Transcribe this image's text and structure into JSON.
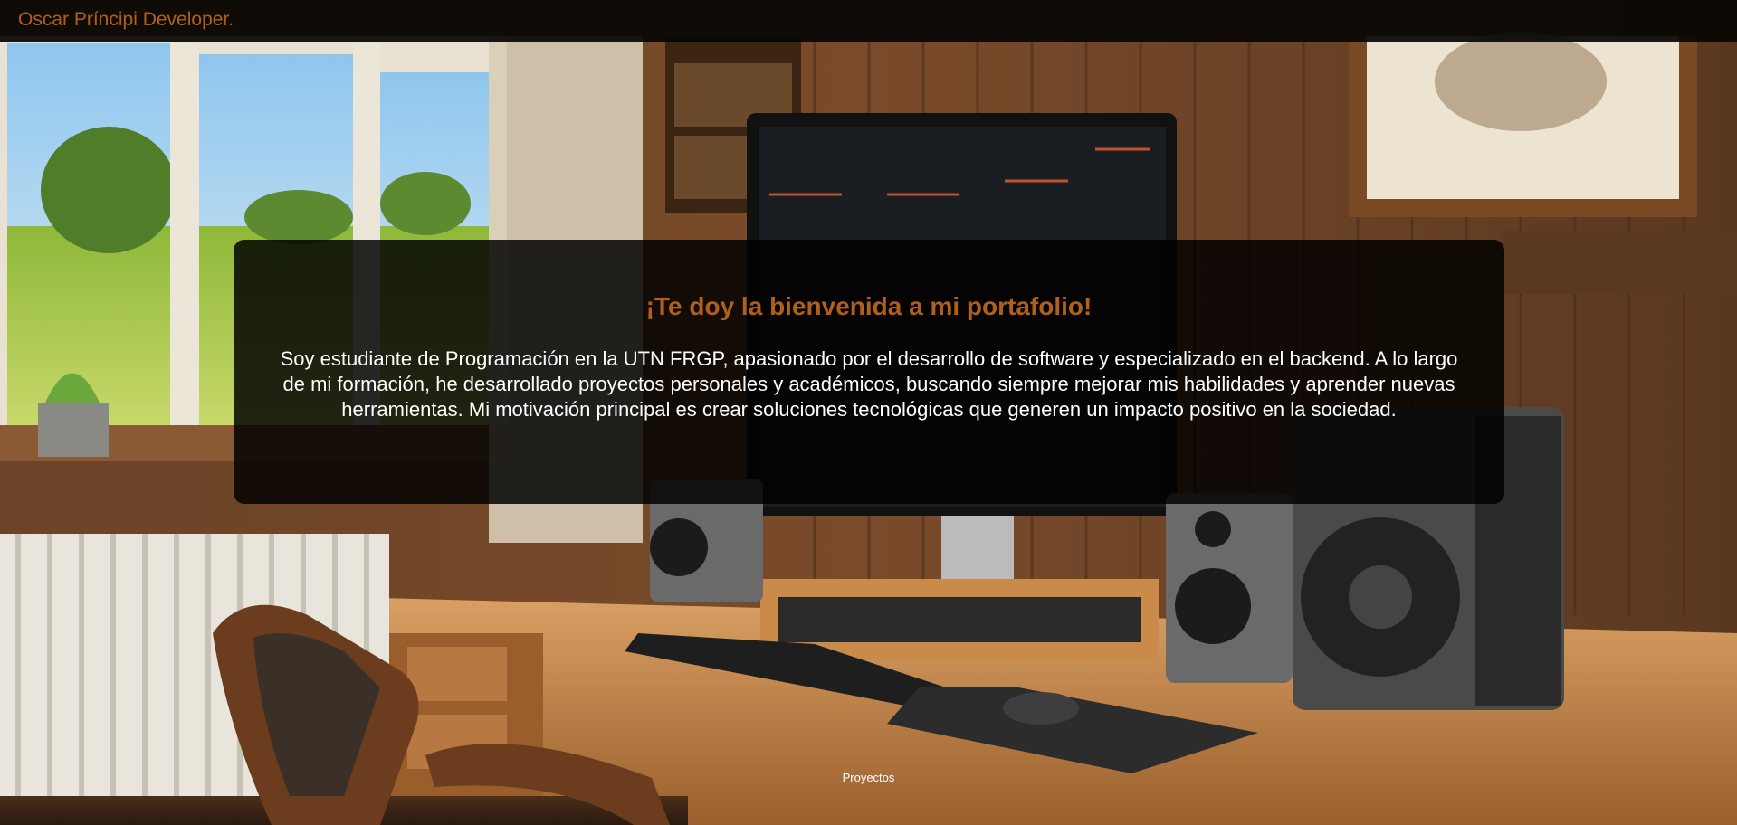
{
  "header": {
    "brand": "Oscar Príncipi Developer."
  },
  "hero": {
    "title": "¡Te doy la bienvenida a mi portafolio!",
    "description": "Soy estudiante de Programación en la UTN FRGP, apasionado por el desarrollo de software y especializado en el backend. A lo largo de mi formación, he desarrollado proyectos personales y académicos, buscando siempre mejorar mis habilidades y aprender nuevas herramientas. Mi motivación principal es crear soluciones tecnológicas que generen un impacto positivo en la sociedad."
  },
  "nav": {
    "projects_label": "Proyectos"
  },
  "colors": {
    "accent": "#b0601a",
    "bar": "#080604",
    "card": "#000000"
  }
}
